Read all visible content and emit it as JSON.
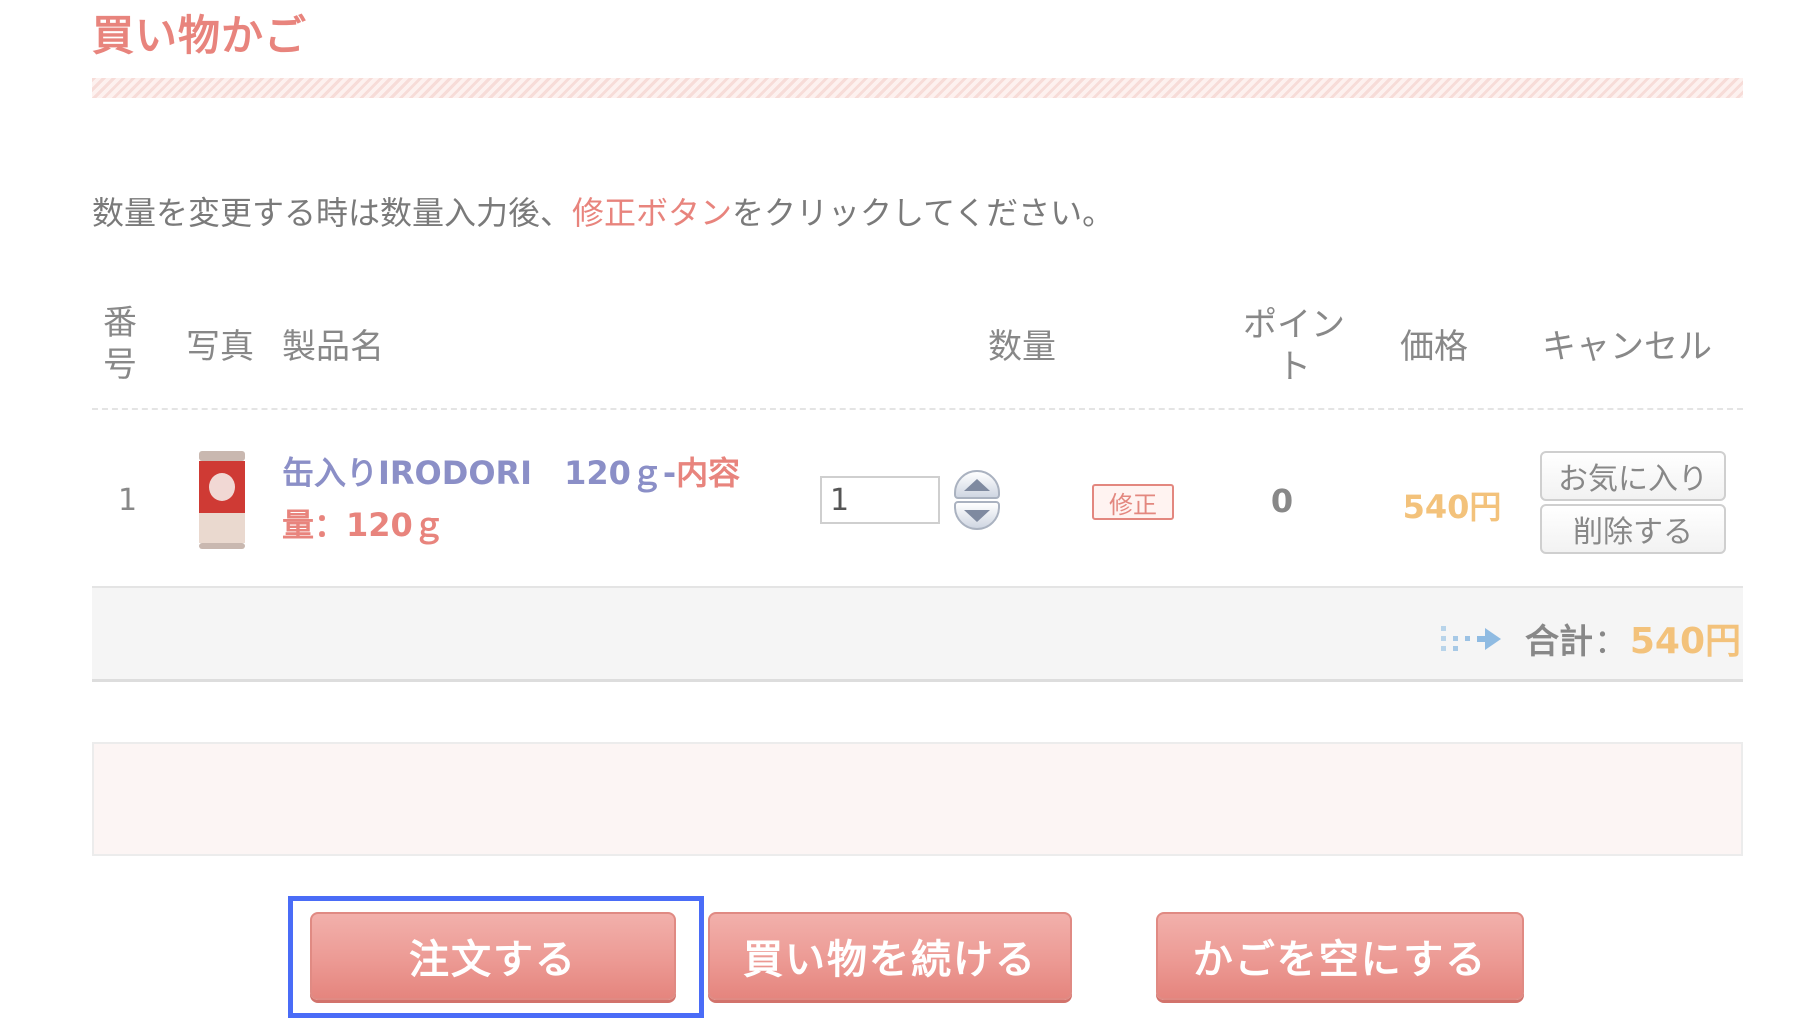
{
  "page": {
    "title": "買い物かご",
    "instruction_before": "数量を変更する時は数量入力後、",
    "instruction_link": "修正ボタン",
    "instruction_after": "をクリックしてください。"
  },
  "table": {
    "headers": {
      "number_line1": "番",
      "number_line2": "号",
      "photo": "写真",
      "product": "製品名",
      "quantity": "数量",
      "points_line1": "ポイン",
      "points_line2": "ト",
      "price": "価格",
      "cancel": "キャンセル"
    },
    "rows": [
      {
        "number": "1",
        "product_name": "缶入りIRODORI　120ｇ-",
        "product_detail": "内容量：120ｇ",
        "quantity": "1",
        "fix_label": "修正",
        "points": "0",
        "price": "540円",
        "favorite_label": "お気に入り",
        "delete_label": "削除する"
      }
    ]
  },
  "total": {
    "label": "合計",
    "colon": "：",
    "value": "540円"
  },
  "actions": {
    "order_label": "注文する",
    "continue_label": "買い物を続ける",
    "empty_cart_label": "かごを空にする"
  },
  "colors": {
    "accent": "#e8847d",
    "price": "#f3c27b",
    "product_link": "#8b8fc7",
    "focus_ring": "#4a6cf7"
  }
}
